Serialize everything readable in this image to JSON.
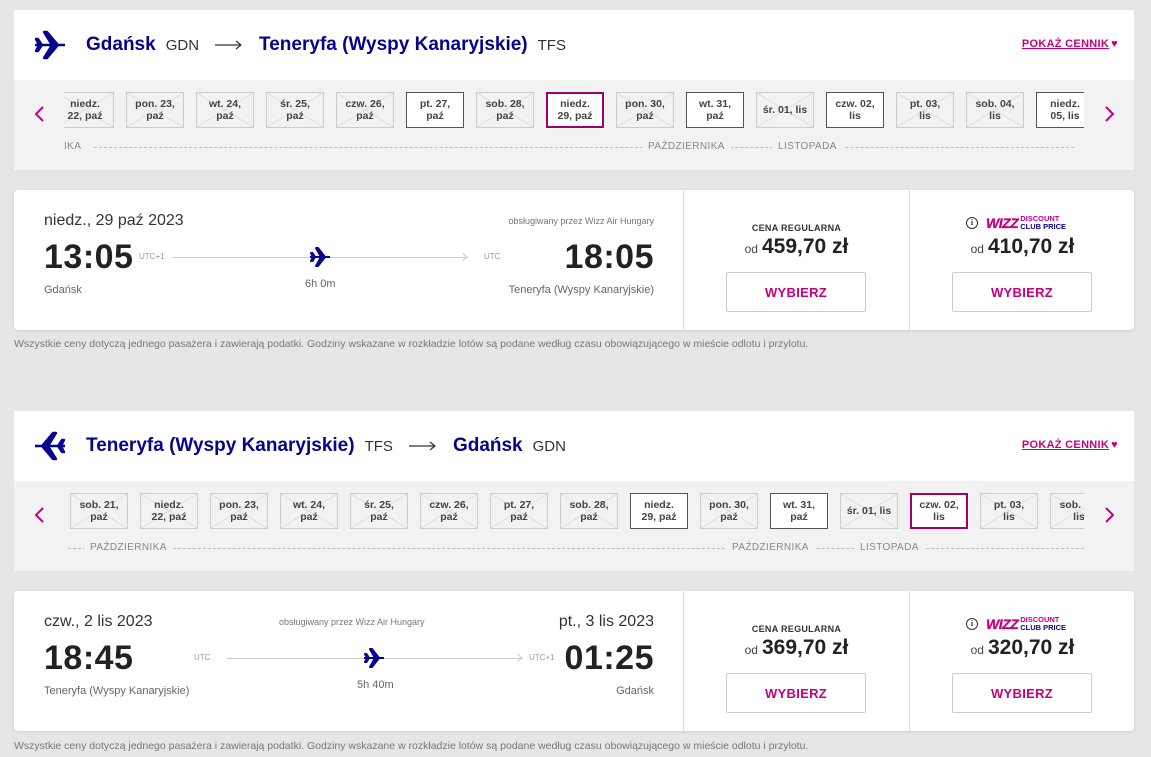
{
  "colors": {
    "brand_navy": "#06038d",
    "brand_magenta": "#c6007e",
    "selected_border": "#a1006b"
  },
  "outbound": {
    "header": {
      "from_city": "Gdańsk",
      "from_code": "GDN",
      "to_city": "Teneryfa (Wyspy Kanaryjskie)",
      "to_code": "TFS",
      "price_link": "POKAŻ CENNIK",
      "plane_icon": "plane-icon",
      "arrow_icon": "long-arrow-right-icon"
    },
    "dates": [
      {
        "l1": "niedz.",
        "l2": "22, paź",
        "state": "none"
      },
      {
        "l1": "pon. 23,",
        "l2": "paź",
        "state": "none"
      },
      {
        "l1": "wt. 24,",
        "l2": "paź",
        "state": "none"
      },
      {
        "l1": "śr. 25,",
        "l2": "paź",
        "state": "none"
      },
      {
        "l1": "czw. 26,",
        "l2": "paź",
        "state": "none"
      },
      {
        "l1": "pt. 27,",
        "l2": "paź",
        "state": "avail"
      },
      {
        "l1": "sob. 28,",
        "l2": "paź",
        "state": "none"
      },
      {
        "l1": "niedz.",
        "l2": "29, paź",
        "state": "sel"
      },
      {
        "l1": "pon. 30,",
        "l2": "paź",
        "state": "none"
      },
      {
        "l1": "wt. 31,",
        "l2": "paź",
        "state": "avail"
      },
      {
        "l1": "śr. 01, lis",
        "l2": "",
        "state": "none"
      },
      {
        "l1": "czw. 02,",
        "l2": "lis",
        "state": "avail"
      },
      {
        "l1": "pt. 03,",
        "l2": "lis",
        "state": "none"
      },
      {
        "l1": "sob. 04,",
        "l2": "lis",
        "state": "none"
      },
      {
        "l1": "niedz.",
        "l2": "05, lis",
        "state": "avail"
      }
    ],
    "months": {
      "left_partial": "IKA",
      "m1": "PAŹDZIERNIKA",
      "m2": "LISTOPADA"
    },
    "flight": {
      "dep_date": "niedz., 29 paź 2023",
      "arr_date": "",
      "operated_by": "obsługiwany przez Wizz Air Hungary",
      "dep_time": "13:05",
      "dep_tz": "UTC+1",
      "arr_time": "18:05",
      "arr_tz": "UTC",
      "duration": "6h 0m",
      "dep_city": "Gdańsk",
      "arr_city": "Teneryfa (Wyspy Kanaryjskie)"
    },
    "regular": {
      "title": "CENA REGULARNA",
      "od": "od",
      "price": "459,70 zł",
      "button": "WYBIERZ"
    },
    "club": {
      "od": "od",
      "price": "410,70 zł",
      "button": "WYBIERZ",
      "logo_word": "WIZZ",
      "logo_l1": "DISCOUNT",
      "logo_l2": "CLUB PRICE"
    }
  },
  "inbound": {
    "header": {
      "from_city": "Teneryfa (Wyspy Kanaryjskie)",
      "from_code": "TFS",
      "to_city": "Gdańsk",
      "to_code": "GDN",
      "price_link": "POKAŻ CENNIK",
      "plane_icon": "plane-icon",
      "arrow_icon": "long-arrow-right-icon"
    },
    "dates": [
      {
        "l1": "sob. 21,",
        "l2": "paź",
        "state": "none"
      },
      {
        "l1": "niedz.",
        "l2": "22, paź",
        "state": "none"
      },
      {
        "l1": "pon. 23,",
        "l2": "paź",
        "state": "none"
      },
      {
        "l1": "wt. 24,",
        "l2": "paź",
        "state": "none"
      },
      {
        "l1": "śr. 25,",
        "l2": "paź",
        "state": "none"
      },
      {
        "l1": "czw. 26,",
        "l2": "paź",
        "state": "none"
      },
      {
        "l1": "pt. 27,",
        "l2": "paź",
        "state": "none"
      },
      {
        "l1": "sob. 28,",
        "l2": "paź",
        "state": "none"
      },
      {
        "l1": "niedz.",
        "l2": "29, paź",
        "state": "avail"
      },
      {
        "l1": "pon. 30,",
        "l2": "paź",
        "state": "none"
      },
      {
        "l1": "wt. 31,",
        "l2": "paź",
        "state": "avail"
      },
      {
        "l1": "śr. 01, lis",
        "l2": "",
        "state": "none"
      },
      {
        "l1": "czw. 02,",
        "l2": "lis",
        "state": "sel"
      },
      {
        "l1": "pt. 03,",
        "l2": "lis",
        "state": "none"
      },
      {
        "l1": "sob. 04,",
        "l2": "lis",
        "state": "none"
      }
    ],
    "months": {
      "left_partial": "PAŹDZIERNIKA",
      "m1": "PAŹDZIERNIKA",
      "m2": "LISTOPADA"
    },
    "flight": {
      "dep_date": "czw., 2 lis 2023",
      "arr_date": "pt., 3 lis 2023",
      "operated_by": "obsługiwany przez Wizz Air Hungary",
      "dep_time": "18:45",
      "dep_tz": "UTC",
      "arr_time": "01:25",
      "arr_tz": "UTC+1",
      "duration": "5h 40m",
      "dep_city": "Teneryfa (Wyspy Kanaryjskie)",
      "arr_city": "Gdańsk"
    },
    "regular": {
      "title": "CENA REGULARNA",
      "od": "od",
      "price": "369,70 zł",
      "button": "WYBIERZ"
    },
    "club": {
      "od": "od",
      "price": "320,70 zł",
      "button": "WYBIERZ",
      "logo_word": "WIZZ",
      "logo_l1": "DISCOUNT",
      "logo_l2": "CLUB PRICE"
    }
  },
  "note": "Wszystkie ceny dotyczą jednego pasażera i zawierają podatki. Godziny wskazane w rozkładzie lotów są podane według czasu obowiązującego w mieście odlotu i przylotu."
}
